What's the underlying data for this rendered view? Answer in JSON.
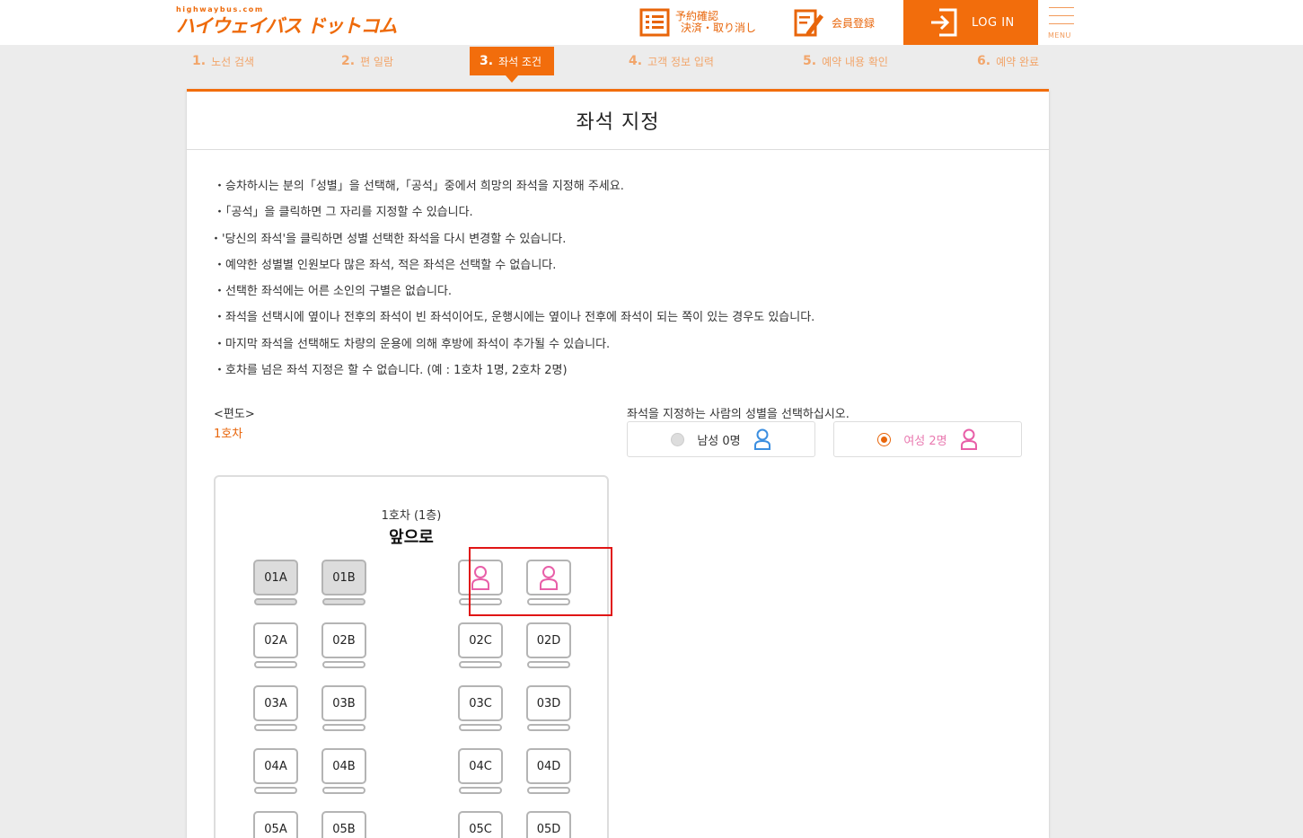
{
  "header": {
    "logo_small": "highwaybus.com",
    "logo_main": "ハイウェイバス ドットコム",
    "reserve_line1": "予約確認",
    "reserve_line2": "決済・取り消し",
    "member_label": "会員登録",
    "login_label": "LOG IN",
    "menu_label": "MENU",
    "accent_color": "#f26d0c"
  },
  "steps": [
    {
      "num": "1.",
      "label": "노선 검색"
    },
    {
      "num": "2.",
      "label": "편 일람"
    },
    {
      "num": "3.",
      "label": "좌석 조건"
    },
    {
      "num": "4.",
      "label": "고객 정보 입력"
    },
    {
      "num": "5.",
      "label": "예약 내용 확인"
    },
    {
      "num": "6.",
      "label": "예약 완료"
    }
  ],
  "active_step": 3,
  "panel": {
    "title": "좌석 지정",
    "notes": [
      "・승차하시는 분의「성별」을 선택해,「공석」중에서 희망의 좌석을 지정해 주세요.",
      "・「공석」을 클릭하면 그 자리를 지정할 수 있습니다.",
      "・'당신의 좌석'을 클릭하면 성별 선택한 좌석을 다시 변경할 수 있습니다.",
      "・예약한 성별별 인원보다 많은 좌석, 적은 좌석은 선택할 수 없습니다.",
      "・선택한 좌석에는 어른 소인의 구별은 없습니다.",
      "・좌석을 선택시에 옆이나 전후의 좌석이 빈 좌석이어도, 운행시에는 옆이나 전후에 좌석이 되는 쪽이 있는 경우도 있습니다.",
      "・마지막 좌석을 선택해도 차량의 운용에 의해 후방에 좌석이 추가될 수 있습니다.",
      "・호차를 넘은 좌석 지정은 할 수 없습니다. (예 : 1호차 1명, 2호차 2명)"
    ],
    "route_label": "<편도>",
    "car_label": "1호차",
    "gender_prompt": "좌석을 지정하는 사람의 성별을 선택하십시오.",
    "male_option": "남성 0명",
    "female_option": "여성 2명",
    "male_color": "#3b8ee0",
    "female_color": "#e85fa8"
  },
  "seatmap": {
    "floor_label": "1호차 (1층)",
    "front_label": "앞으로",
    "rows": [
      [
        "01A",
        "01B",
        "",
        ""
      ],
      [
        "02A",
        "02B",
        "02C",
        "02D"
      ],
      [
        "03A",
        "03B",
        "03C",
        "03D"
      ],
      [
        "04A",
        "04B",
        "04C",
        "04D"
      ],
      [
        "05A",
        "05B",
        "05C",
        "05D"
      ]
    ],
    "taken_seats": [
      "01A",
      "01B"
    ],
    "selected_seats": [
      "01C",
      "01D"
    ]
  }
}
